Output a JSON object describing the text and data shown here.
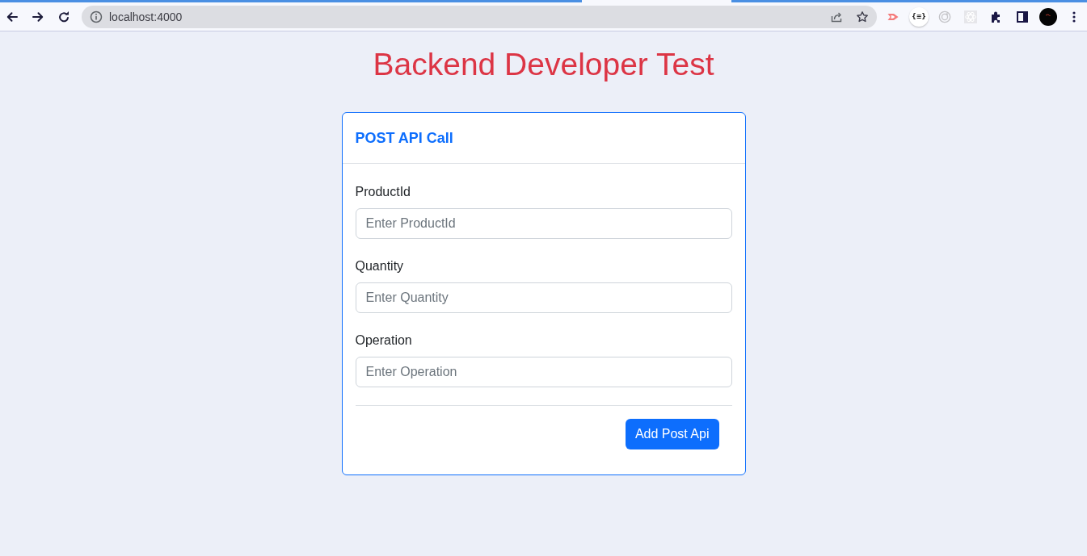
{
  "browser": {
    "address": "localhost:4000",
    "extension_label": "{≡}"
  },
  "page": {
    "title": "Backend Developer Test"
  },
  "card": {
    "title": "POST API Call",
    "fields": [
      {
        "label": "ProductId",
        "placeholder": "Enter ProductId"
      },
      {
        "label": "Quantity",
        "placeholder": "Enter Quantity"
      },
      {
        "label": "Operation",
        "placeholder": "Enter Operation"
      }
    ],
    "submit_button": "Add Post Api"
  }
}
